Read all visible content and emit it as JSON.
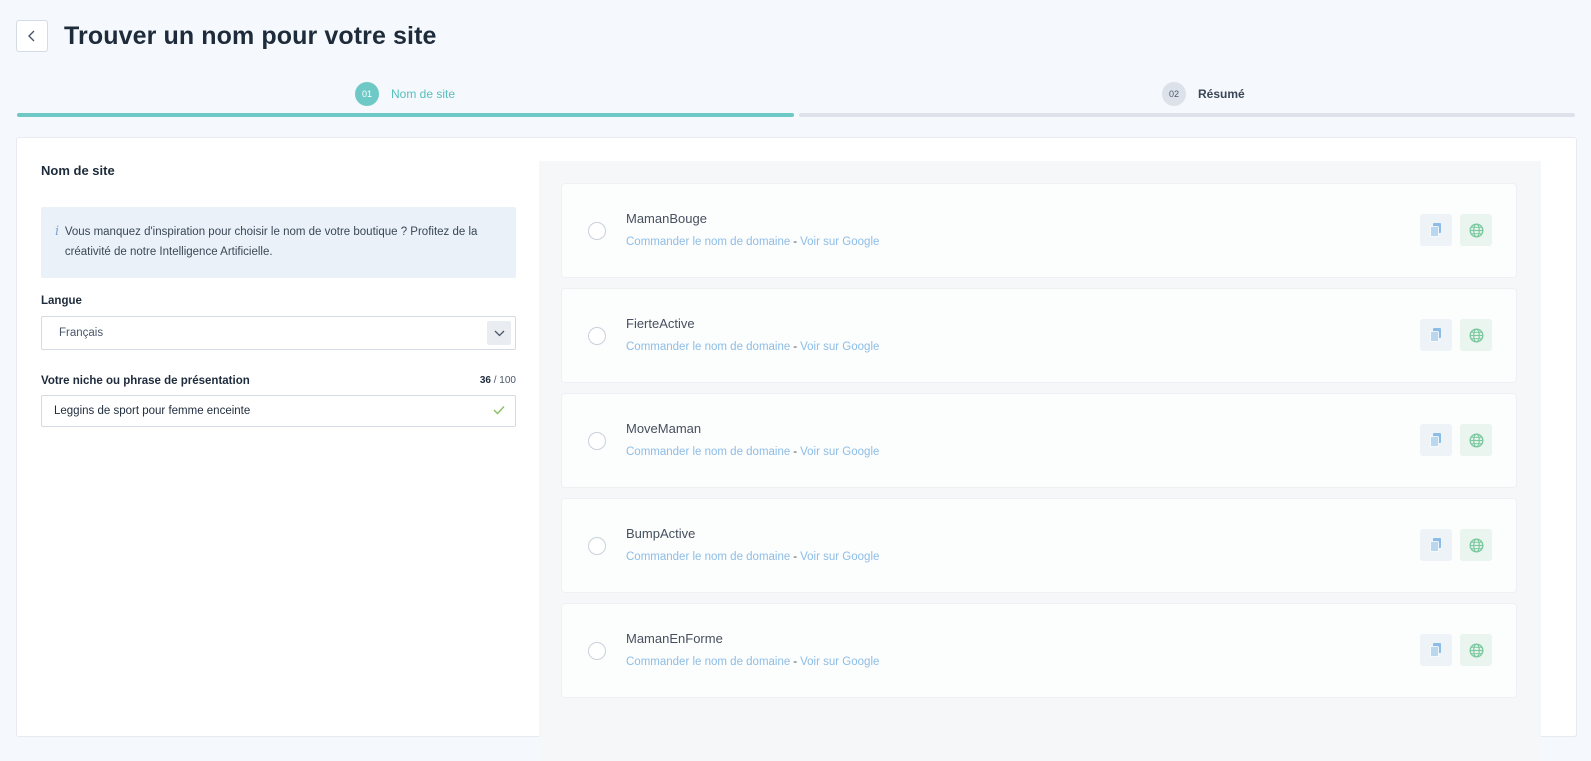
{
  "header": {
    "title": "Trouver un nom pour votre site"
  },
  "stepper": {
    "steps": [
      {
        "number": "01",
        "label": "Nom de site",
        "state": "active"
      },
      {
        "number": "02",
        "label": "Résumé",
        "state": "pending"
      }
    ]
  },
  "form": {
    "section_title": "Nom de site",
    "info_text": "Vous manquez d'inspiration pour choisir le nom de votre boutique ? Profitez de la créativité de notre Intelligence Artificielle.",
    "language_label": "Langue",
    "language_value": "Français",
    "niche_label": "Votre niche ou phrase de présentation",
    "niche_count": "36",
    "niche_max": "/ 100",
    "niche_value": "Leggins de sport pour femme enceinte"
  },
  "results": {
    "order_link": "Commander le nom de domaine",
    "separator": "-",
    "google_link": "Voir sur Google",
    "items": [
      {
        "name": "MamanBouge"
      },
      {
        "name": "FierteActive"
      },
      {
        "name": "MoveMaman"
      },
      {
        "name": "BumpActive"
      },
      {
        "name": "MamanEnForme"
      }
    ]
  },
  "colors": {
    "accent": "#6ec9c6",
    "link": "#8dbde6",
    "success": "#7cc9a0"
  }
}
